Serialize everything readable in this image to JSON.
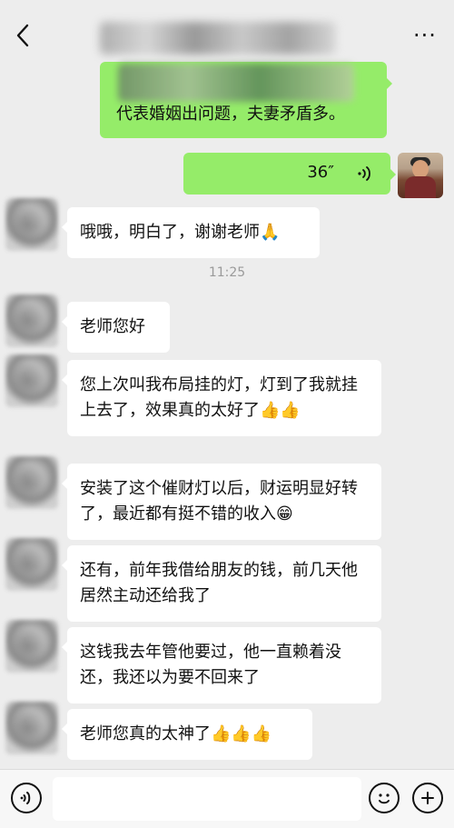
{
  "header": {
    "back_icon": "back-chevron-icon",
    "more_label": "···",
    "more_icon": "more-dots-icon"
  },
  "messages": {
    "m0_tail_text": "代表婚姻出问题，夫妻矛盾多。",
    "m1_voice_duration": "36″",
    "m2_text": "哦哦，明白了，谢谢老师🙏",
    "timestamp": "11:25",
    "m3_text": "老师您好",
    "m4_text": "您上次叫我布局挂的灯，灯到了我就挂上去了，效果真的太好了👍👍",
    "m5_text": "安装了这个催财灯以后，财运明显好转了，最近都有挺不错的收入😁",
    "m6_text": "还有，前年我借给朋友的钱，前几天他居然主动还给我了",
    "m7_text": "这钱我去年管他要过，他一直赖着没还，我还以为要不回来了",
    "m8_text": "老师您真的太神了👍👍👍"
  },
  "input": {
    "voice_icon": "voice-input-icon",
    "emoji_icon": "emoji-icon",
    "plus_icon": "plus-icon"
  },
  "colors": {
    "background": "#ededed",
    "my_bubble": "#95ec69",
    "their_bubble": "#ffffff",
    "timestamp": "#9a9a9a"
  }
}
